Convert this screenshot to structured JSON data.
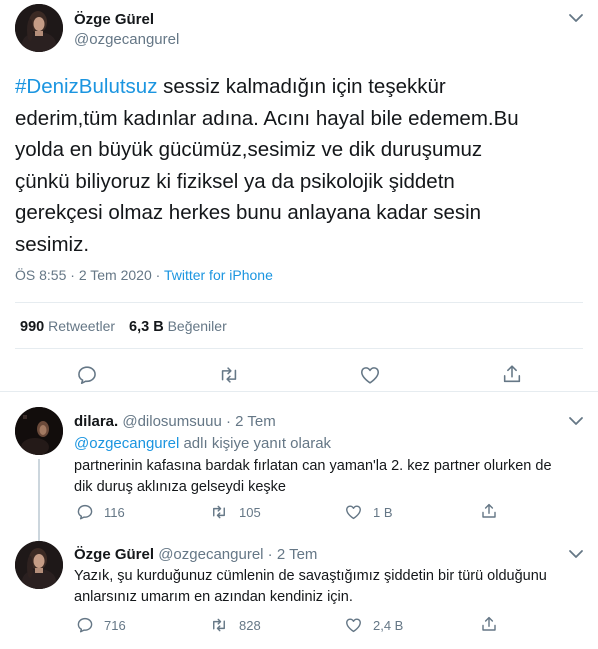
{
  "main_tweet": {
    "author_name": "Özge Gürel",
    "author_handle": "@ozgecangurel",
    "text_lines": [
      {
        "hashtag": "#DenizBulutsuz",
        "text": " sessiz kalmadığın için teşekkür"
      },
      {
        "hashtag": "",
        "text": "ederim,tüm kadınlar adına. Acını hayal bile edemem.Bu"
      },
      {
        "hashtag": "",
        "text": "yolda en büyük gücümüz,sesimiz ve dik duruşumuz"
      },
      {
        "hashtag": "",
        "text": "çünkü biliyoruz ki fiziksel ya da psikolojik şiddetn"
      },
      {
        "hashtag": "",
        "text": "gerekçesi olmaz herkes bunu anlayana kadar sesin"
      },
      {
        "hashtag": "",
        "text": "sesimiz."
      }
    ],
    "time": "ÖS 8:55",
    "date": "2 Tem 2020",
    "meta_sep": " · ",
    "source": "Twitter for iPhone",
    "retweets_count": "990",
    "retweets_label": "Retweetler",
    "likes_count": "6,3 B",
    "likes_label": "Beğeniler"
  },
  "replies": [
    {
      "name": "dilara.",
      "handle": "@dilosumsuuu",
      "sep": " · ",
      "date": "2 Tem",
      "reply_to_mention": "@ozgecangurel",
      "reply_to_suffix": " adlı kişiye yanıt olarak",
      "text_lines": [
        "partnerinin kafasına bardak fırlatan can yaman'la 2. kez partner olurken de",
        "dik duruş aklınıza gelseydi keşke"
      ],
      "replies_count": "116",
      "retweets_count": "105",
      "likes_count": "1 B"
    },
    {
      "name": "Özge Gürel",
      "handle": "@ozgecangurel",
      "sep": " · ",
      "date": "2 Tem",
      "text_lines": [
        "Yazık, şu kurduğunuz cümlenin de savaştığımız şiddetin bir türü olduğunu",
        "anlarsınız umarım en azından kendiniz için."
      ],
      "replies_count": "716",
      "retweets_count": "828",
      "likes_count": "2,4 B"
    }
  ],
  "icons": {
    "reply": "reply-icon",
    "retweet": "retweet-icon",
    "like": "heart-icon",
    "share": "share-icon",
    "more": "chevron-down-icon"
  },
  "colors": {
    "link": "#1b95e0",
    "muted": "#657786",
    "text": "#14171a",
    "border": "#e6ecf0"
  }
}
